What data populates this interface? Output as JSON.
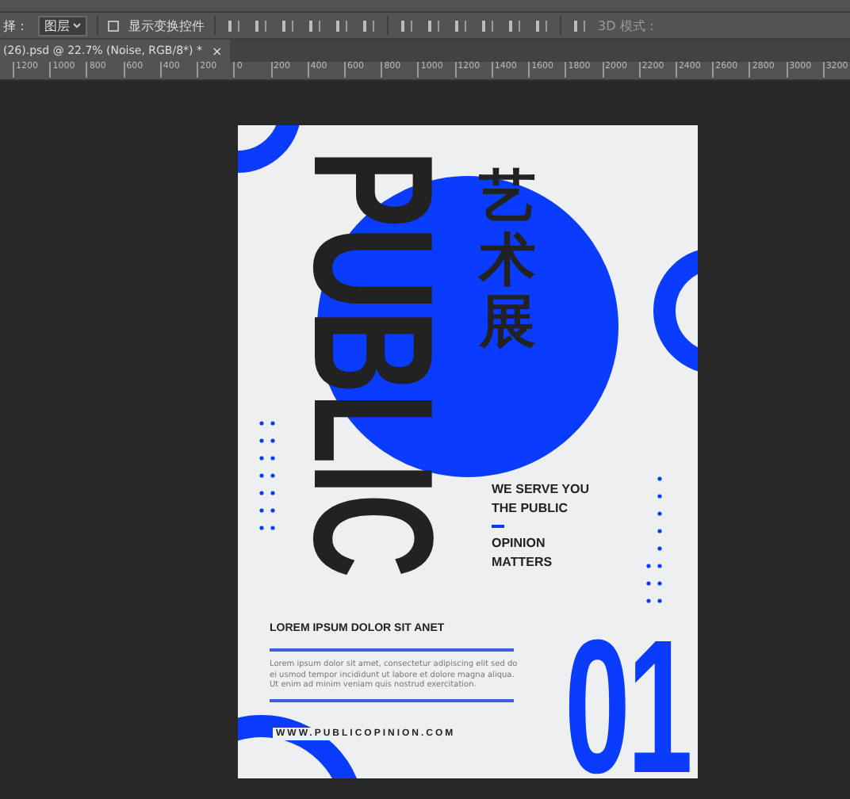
{
  "options_bar": {
    "label": "择：",
    "layer_select": "图层",
    "show_transform": {
      "label": "显示变换控件",
      "checked": false
    },
    "mode_label": "3D 模式："
  },
  "document_tab": {
    "title": "(26).psd @ 22.7% (Noise, RGB/8*) *",
    "close": "×"
  },
  "ruler": [
    "1200",
    "1000",
    "800",
    "600",
    "400",
    "200",
    "0",
    "200",
    "400",
    "600",
    "800",
    "1000",
    "1200",
    "1400",
    "1600",
    "1800",
    "2000",
    "2200",
    "2400",
    "2600",
    "2800",
    "3000",
    "3200"
  ],
  "poster": {
    "headline": "PUBLIC",
    "chinese_title": "艺术展",
    "tagline": [
      "WE SERVE YOU",
      "THE PUBLIC"
    ],
    "subline": [
      "OPINION",
      "MATTERS"
    ],
    "heading": "LOREM IPSUM DOLOR SIT ANET",
    "body": "Lorem ipsum dolor sit amet, consectetur adipiscing elit sed do ei usmod tempor incididunt ut labore et dolore magna aliqua. Ut enim ad minim veniam quis nostrud exercitation.",
    "website": "WWW.PUBLICOPINION.COM",
    "number": "01"
  }
}
